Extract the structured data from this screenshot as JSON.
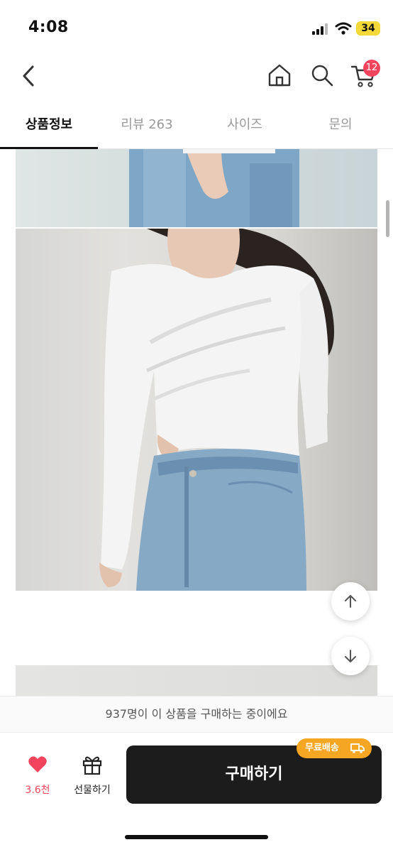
{
  "status_bar": {
    "time": "4:08",
    "battery": "34",
    "battery_color": "#f3d83a"
  },
  "header": {
    "icons": [
      "back-icon",
      "home-icon",
      "search-icon",
      "cart-icon"
    ],
    "cart_count": "12",
    "badge_color": "#f2455d"
  },
  "tabs": [
    {
      "label": "상품정보",
      "active": true
    },
    {
      "label": "리뷰 263",
      "active": false
    },
    {
      "label": "사이즈",
      "active": false
    },
    {
      "label": "문의",
      "active": false
    }
  ],
  "content": {
    "images": [
      "product-photo-jeans-closeup",
      "product-photo-white-top",
      "product-photo-next"
    ],
    "floating_buttons": [
      "scroll-up-icon",
      "scroll-down-icon"
    ]
  },
  "notice": "937명이 이 상품을 구매하는 중이에요",
  "bottom_bar": {
    "like_count": "3.6천",
    "gift_label": "선물하기",
    "buy_label": "구매하기",
    "shipping_badge": "무료배송",
    "accent_color": "#f2455d",
    "badge_color": "#f5a623"
  }
}
